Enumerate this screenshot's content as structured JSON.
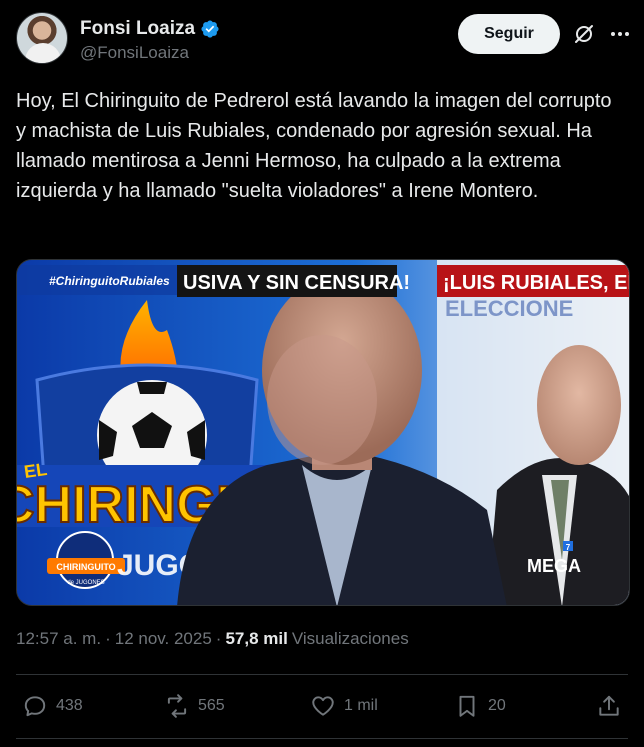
{
  "author": {
    "display_name": "Fonsi Loaiza",
    "handle": "@FonsiLoaiza",
    "verified_color": "#1d9bf0"
  },
  "header": {
    "follow_label": "Seguir",
    "grok_icon": "grok-icon",
    "more_icon": "more-options-icon"
  },
  "tweet": {
    "text": "Hoy, El Chiringuito de Pedrerol está lavando la imagen del corrupto y machista de Luis Rubiales, condenado por agresión sexual. Ha llamado mentirosa a Jenni Hermoso, ha culpado a la extrema izquierda y ha llamado \"suelta violadores\" a Irene Montero."
  },
  "media": {
    "hashtag": "#ChiringuitoRubiales",
    "banner_left": "USIVA Y SIN CENSURA!",
    "banner_right": "¡LUIS RUBIALES, EN",
    "background_word": "ELECCIONE",
    "logo_el": "EL",
    "logo_main": "CHIRINGUITO",
    "logo_small_top": "CHIRINGUITO",
    "logo_small_bottom": "de JUGONES",
    "logo_bottom_partial": "JUGONES",
    "channel_mark": "MEGA",
    "channel_number": "7"
  },
  "meta": {
    "time": "12:57 a. m.",
    "separator": "·",
    "date": "12 nov. 2025",
    "views_count": "57,8 mil",
    "views_label": "Visualizaciones"
  },
  "actions": {
    "replies": "438",
    "reposts": "565",
    "likes": "1 mil",
    "bookmarks": "20"
  }
}
